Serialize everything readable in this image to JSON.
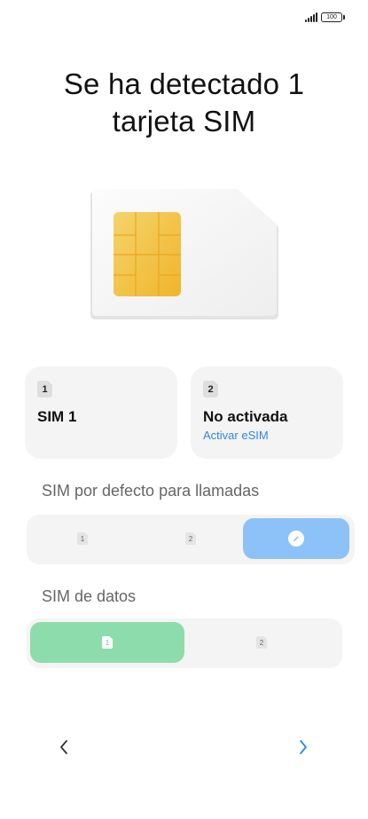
{
  "status": {
    "battery": "100"
  },
  "title": {
    "line1": "Se ha detectado 1",
    "line2": "tarjeta SIM"
  },
  "sim_cards": [
    {
      "slot": "1",
      "name": "SIM 1",
      "link": ""
    },
    {
      "slot": "2",
      "name": "No activada",
      "link": "Activar eSIM"
    }
  ],
  "calls": {
    "label": "SIM por defecto para llamadas",
    "options": [
      "1",
      "2"
    ],
    "selected": "always-ask"
  },
  "data": {
    "label": "SIM de datos",
    "options": [
      "1",
      "2"
    ],
    "selected": "1"
  },
  "navigation": {
    "back_icon": "chevron-left-icon",
    "next_icon": "chevron-right-icon"
  },
  "colors": {
    "accent_blue": "#2f87e6",
    "calls_selected": "#8cc2f7",
    "data_selected": "#8ddcab",
    "chip_gold": "#f3c23c"
  }
}
